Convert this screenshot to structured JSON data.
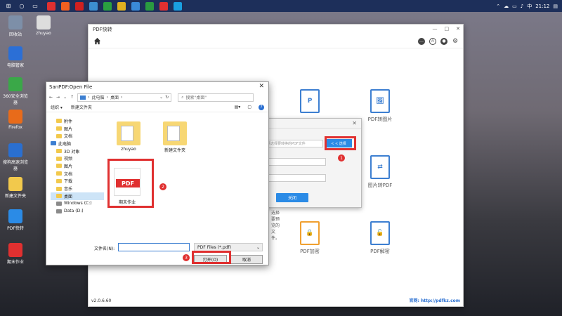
{
  "taskbar": {
    "time": "21:12",
    "ime": "中",
    "search_glyph": "○",
    "start_glyph": "⊞",
    "app_colors": [
      "#e03030",
      "#f06020",
      "#d02020",
      "#3c8fd0",
      "#2aa040",
      "#e0b020",
      "#3a8ad8",
      "#2a9a40",
      "#e03030",
      "#1aa0e0"
    ]
  },
  "desktop": {
    "icons": [
      {
        "label": "回收站",
        "color": "#7d8fa8"
      },
      {
        "label": "zhuyao",
        "color": "#ddd"
      },
      {
        "label": "电脑管家",
        "color": "#2b6fd6"
      },
      {
        "label": "360安全浏览器",
        "color": "#3aa848"
      },
      {
        "label": "Firefox",
        "color": "#e86b1a"
      },
      {
        "label": "搜狗高速浏览器",
        "color": "#2a6fd0"
      },
      {
        "label": "新建文件夹",
        "color": "#f2c94c"
      },
      {
        "label": "PDF快转",
        "color": "#2b8be6"
      },
      {
        "label": "期末作业",
        "color": "#e03030"
      }
    ]
  },
  "pdf_app": {
    "title": "PDF快转",
    "window_controls": [
      "—",
      "□",
      "✕"
    ],
    "features": [
      {
        "label": "",
        "glyph": "P"
      },
      {
        "label": "PDF转图片",
        "glyph": "🖼"
      },
      {
        "label": "图片转PDF",
        "glyph": "⇄"
      },
      {
        "label": "PDF加密",
        "glyph": "🔒"
      },
      {
        "label": "PDF解密",
        "glyph": "🔓"
      }
    ],
    "version": "v2.0.6.60",
    "website": "官网: http://pdfkz.com"
  },
  "convert_dialog": {
    "close": "✕",
    "input1_placeholder": "请选择要转换的PDF文件",
    "select_button": "< < 选择",
    "close_button": "关闭"
  },
  "open_dialog": {
    "title": "SanPDF:Open File",
    "close": "✕",
    "path": [
      "此电脑",
      "桌面"
    ],
    "search_placeholder": "搜索\"桌面\"",
    "organize": "组织 ▾",
    "new_folder": "新建文件夹",
    "sidebar": [
      {
        "label": "附件",
        "type": "folder"
      },
      {
        "label": "图片",
        "type": "folder"
      },
      {
        "label": "文档",
        "type": "folder"
      },
      {
        "label": "此电脑",
        "type": "pc"
      },
      {
        "label": "3D 对象",
        "type": "folder"
      },
      {
        "label": "视频",
        "type": "folder"
      },
      {
        "label": "图片",
        "type": "folder"
      },
      {
        "label": "文档",
        "type": "folder"
      },
      {
        "label": "下载",
        "type": "folder"
      },
      {
        "label": "音乐",
        "type": "folder"
      },
      {
        "label": "桌面",
        "type": "folder",
        "selected": true
      },
      {
        "label": "Windows (C:)",
        "type": "drive"
      },
      {
        "label": "Data (D:)",
        "type": "drive"
      }
    ],
    "files": [
      {
        "label": "zhuyao",
        "type": "folder"
      },
      {
        "label": "新建文件夹",
        "type": "folder"
      },
      {
        "label": "期末作业",
        "type": "pdf"
      }
    ],
    "pdf_tag": "PDF",
    "preview_hint": "选择要预览的文件。",
    "filename_label": "文件名(N):",
    "filter": "PDF Files (*.pdf)",
    "open_button": "打开(O)",
    "cancel_button": "取消"
  },
  "annotations": [
    "1",
    "2",
    "3"
  ]
}
